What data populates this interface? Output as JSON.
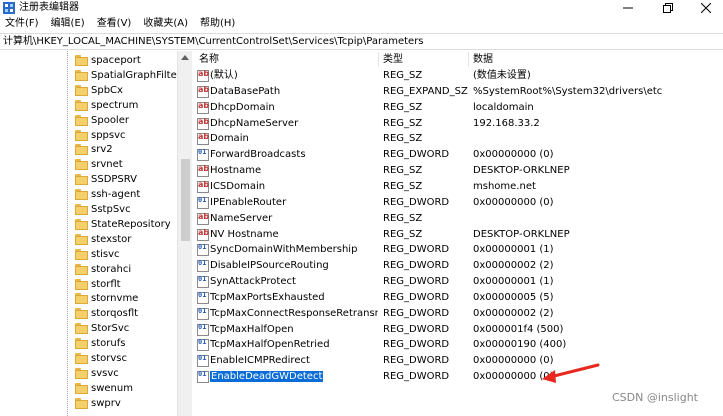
{
  "window": {
    "title": "注册表编辑器",
    "icon": "regedit-icon",
    "controls": {
      "minimize": "minimize-icon",
      "maximize": "restore-icon",
      "close": "close-icon"
    }
  },
  "menu": [
    "文件(F)",
    "编辑(E)",
    "查看(V)",
    "收藏夹(A)",
    "帮助(H)"
  ],
  "address": "计算机\\HKEY_LOCAL_MACHINE\\SYSTEM\\CurrentControlSet\\Services\\Tcpip\\Parameters",
  "tree": [
    "spaceport",
    "SpatialGraphFilter",
    "SpbCx",
    "spectrum",
    "Spooler",
    "sppsvc",
    "srv2",
    "srvnet",
    "SSDPSRV",
    "ssh-agent",
    "SstpSvc",
    "StateRepository",
    "stexstor",
    "stisvc",
    "storahci",
    "storflt",
    "stornvme",
    "storqosflt",
    "StorSvc",
    "storufs",
    "storvsc",
    "svsvc",
    "swenum",
    "swprv"
  ],
  "columns": {
    "name": "名称",
    "type": "类型",
    "data": "数据"
  },
  "values": [
    {
      "name": "(默认)",
      "type": "REG_SZ",
      "data": "(数值未设置)",
      "icon": "sz"
    },
    {
      "name": "DataBasePath",
      "type": "REG_EXPAND_SZ",
      "data": "%SystemRoot%\\System32\\drivers\\etc",
      "icon": "sz"
    },
    {
      "name": "DhcpDomain",
      "type": "REG_SZ",
      "data": "localdomain",
      "icon": "sz"
    },
    {
      "name": "DhcpNameServer",
      "type": "REG_SZ",
      "data": "192.168.33.2",
      "icon": "sz"
    },
    {
      "name": "Domain",
      "type": "REG_SZ",
      "data": "",
      "icon": "sz"
    },
    {
      "name": "ForwardBroadcasts",
      "type": "REG_DWORD",
      "data": "0x00000000 (0)",
      "icon": "dword"
    },
    {
      "name": "Hostname",
      "type": "REG_SZ",
      "data": "DESKTOP-ORKLNEP",
      "icon": "sz"
    },
    {
      "name": "ICSDomain",
      "type": "REG_SZ",
      "data": "mshome.net",
      "icon": "sz"
    },
    {
      "name": "IPEnableRouter",
      "type": "REG_DWORD",
      "data": "0x00000000 (0)",
      "icon": "dword"
    },
    {
      "name": "NameServer",
      "type": "REG_SZ",
      "data": "",
      "icon": "sz"
    },
    {
      "name": "NV Hostname",
      "type": "REG_SZ",
      "data": "DESKTOP-ORKLNEP",
      "icon": "sz"
    },
    {
      "name": "SyncDomainWithMembership",
      "type": "REG_DWORD",
      "data": "0x00000001 (1)",
      "icon": "dword"
    },
    {
      "name": "DisableIPSourceRouting",
      "type": "REG_DWORD",
      "data": "0x00000002 (2)",
      "icon": "dword"
    },
    {
      "name": "SynAttackProtect",
      "type": "REG_DWORD",
      "data": "0x00000001 (1)",
      "icon": "dword"
    },
    {
      "name": "TcpMaxPortsExhausted",
      "type": "REG_DWORD",
      "data": "0x00000005 (5)",
      "icon": "dword"
    },
    {
      "name": "TcpMaxConnectResponseRetransmi...",
      "type": "REG_DWORD",
      "data": "0x00000002 (2)",
      "icon": "dword"
    },
    {
      "name": "TcpMaxHalfOpen",
      "type": "REG_DWORD",
      "data": "0x000001f4 (500)",
      "icon": "dword"
    },
    {
      "name": "TcpMaxHalfOpenRetried",
      "type": "REG_DWORD",
      "data": "0x00000190 (400)",
      "icon": "dword"
    },
    {
      "name": "EnableICMPRedirect",
      "type": "REG_DWORD",
      "data": "0x00000000 (0)",
      "icon": "dword"
    },
    {
      "name": "EnableDeadGWDetect",
      "type": "REG_DWORD",
      "data": "0x00000000 (0)",
      "icon": "dword",
      "selected": true
    }
  ],
  "annotation": {
    "arrow_color": "#e8281e"
  },
  "watermark": "CSDN @inslight"
}
